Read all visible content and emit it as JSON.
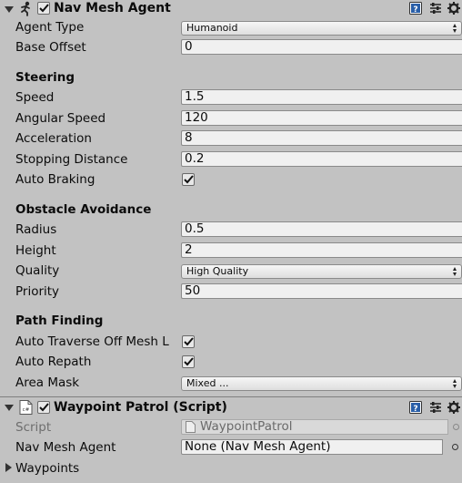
{
  "nav_mesh_agent": {
    "title": "Nav Mesh Agent",
    "enabled": true,
    "agent_type_label": "Agent Type",
    "agent_type_value": "Humanoid",
    "base_offset_label": "Base Offset",
    "base_offset_value": "0",
    "steering": {
      "title": "Steering",
      "speed_label": "Speed",
      "speed_value": "1.5",
      "angular_speed_label": "Angular Speed",
      "angular_speed_value": "120",
      "acceleration_label": "Acceleration",
      "acceleration_value": "8",
      "stopping_distance_label": "Stopping Distance",
      "stopping_distance_value": "0.2",
      "auto_braking_label": "Auto Braking",
      "auto_braking": true
    },
    "obstacle_avoidance": {
      "title": "Obstacle Avoidance",
      "radius_label": "Radius",
      "radius_value": "0.5",
      "height_label": "Height",
      "height_value": "2",
      "quality_label": "Quality",
      "quality_value": "High Quality",
      "priority_label": "Priority",
      "priority_value": "50"
    },
    "path_finding": {
      "title": "Path Finding",
      "auto_traverse_label": "Auto Traverse Off Mesh L",
      "auto_traverse": true,
      "auto_repath_label": "Auto Repath",
      "auto_repath": true,
      "area_mask_label": "Area Mask",
      "area_mask_value": "Mixed ..."
    }
  },
  "waypoint_patrol": {
    "title": "Waypoint Patrol (Script)",
    "enabled": true,
    "script_icon_text": "c#",
    "script_label": "Script",
    "script_value": "WaypointPatrol",
    "nav_mesh_agent_label": "Nav Mesh Agent",
    "nav_mesh_agent_value": "None (Nav Mesh Agent)",
    "waypoints_label": "Waypoints"
  },
  "colors": {
    "background": "#c2c2c2",
    "help_icon": "#2a5fa8"
  },
  "icons": [
    "foldout-open-icon",
    "nav-mesh-agent-icon",
    "checkbox-check-icon",
    "help-icon",
    "preset-icon",
    "gear-icon",
    "dropdown-arrow-icon",
    "object-picker-icon",
    "script-icon",
    "foldout-closed-icon"
  ]
}
